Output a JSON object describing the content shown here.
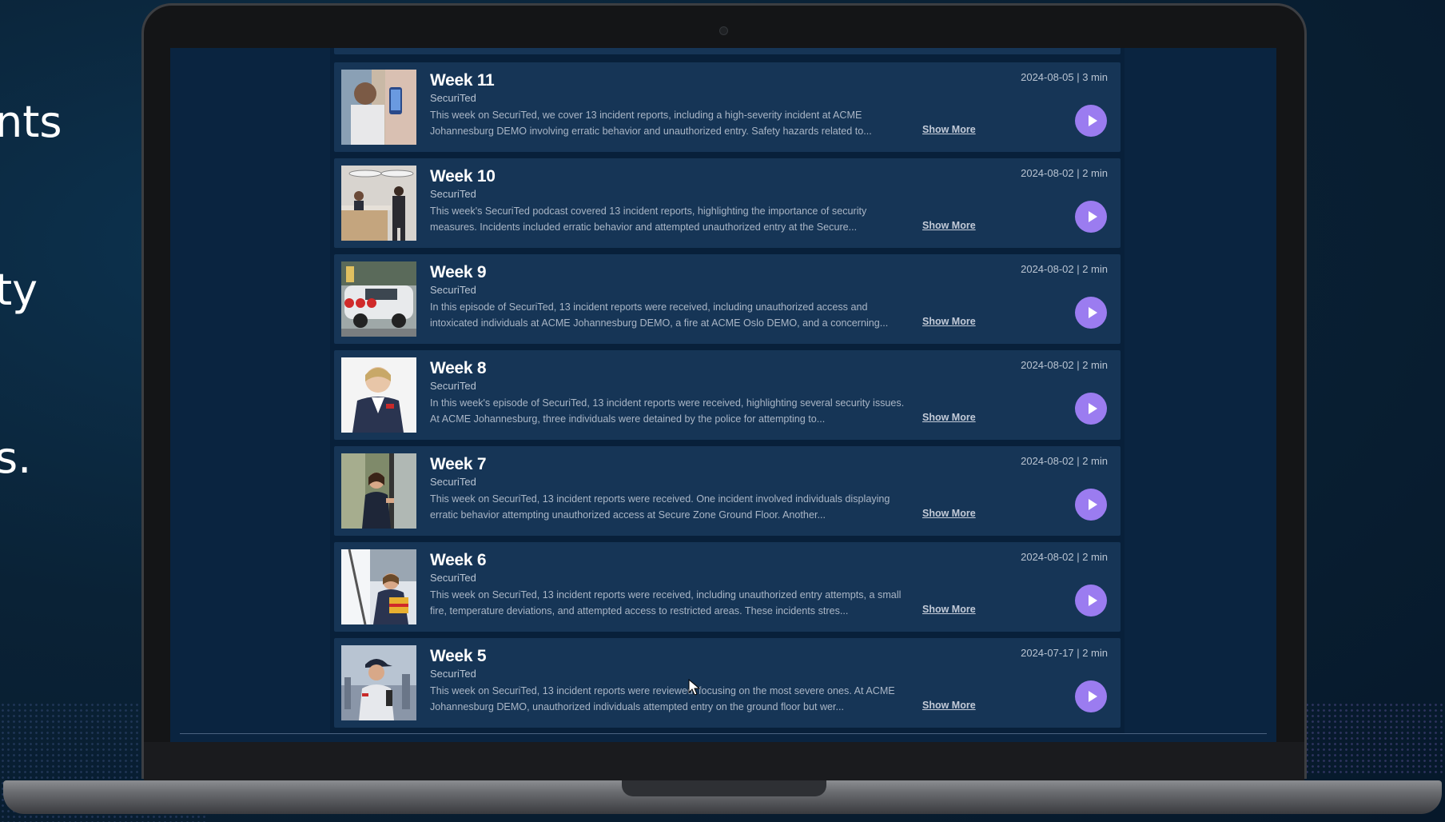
{
  "hero": {
    "line1": "nts",
    "line2": "ty",
    "line3": "s."
  },
  "episodes": [
    {
      "title": "Week 11",
      "show": "SecuriTed",
      "description": "This week on SecuriTed, we cover 13 incident reports, including a high-severity incident at ACME Johannesburg DEMO involving erratic behavior and unauthorized entry. Safety hazards related to...",
      "more": "Show More",
      "meta": "2024-08-05 | 3 min",
      "thumb_icon": "man-with-phone-photo"
    },
    {
      "title": "Week 10",
      "show": "SecuriTed",
      "description": "This week's SecuriTed podcast covered 13 incident reports, highlighting the importance of security measures. Incidents included erratic behavior and attempted unauthorized entry at the Secure...",
      "more": "Show More",
      "meta": "2024-08-02 | 2 min",
      "thumb_icon": "reception-desk-photo"
    },
    {
      "title": "Week 9",
      "show": "SecuriTed",
      "description": "In this episode of SecuriTed, 13 incident reports were received, including unauthorized access and intoxicated individuals at ACME Johannesburg DEMO, a fire at ACME Oslo DEMO, and a concerning...",
      "more": "Show More",
      "meta": "2024-08-02 | 2 min",
      "thumb_icon": "security-car-photo"
    },
    {
      "title": "Week 8",
      "show": "SecuriTed",
      "description": "In this week's episode of SecuriTed, 13 incident reports were received, highlighting several security issues. At ACME Johannesburg, three individuals were detained by the police for attempting to...",
      "more": "Show More",
      "meta": "2024-08-02 | 2 min",
      "thumb_icon": "guard-woman-photo"
    },
    {
      "title": "Week 7",
      "show": "SecuriTed",
      "description": "This week on SecuriTed, 13 incident reports were received. One incident involved individuals displaying erratic behavior attempting unauthorized access at Secure Zone Ground Floor. Another...",
      "more": "Show More",
      "meta": "2024-08-02 | 2 min",
      "thumb_icon": "guard-door-photo"
    },
    {
      "title": "Week 6",
      "show": "SecuriTed",
      "description": "This week on SecuriTed, 13 incident reports were received, including unauthorized entry attempts, a small fire, temperature deviations, and attempted access to restricted areas. These incidents stres...",
      "more": "Show More",
      "meta": "2024-08-02 | 2 min",
      "thumb_icon": "guard-window-photo"
    },
    {
      "title": "Week 5",
      "show": "SecuriTed",
      "description": "This week on SecuriTed, 13 incident reports were reviewed, focusing on the most severe ones. At ACME Johannesburg DEMO, unauthorized individuals attempted entry on the ground floor but wer...",
      "more": "Show More",
      "meta": "2024-07-17 | 2 min",
      "thumb_icon": "guard-cap-photo"
    }
  ],
  "colors": {
    "card_bg": "#163556",
    "play_button": "#9b7cf0",
    "screen_bg": "#08203a"
  }
}
